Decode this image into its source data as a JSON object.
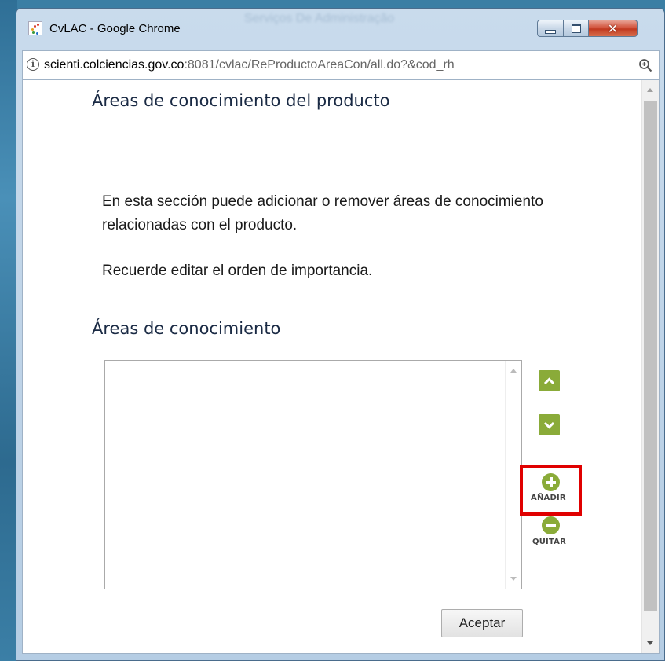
{
  "window": {
    "title": "CvLAC - Google Chrome",
    "background_title": "Serviços De Administração"
  },
  "address": {
    "host": "scienti.colciencias.gov.co",
    "rest": ":8081/cvlac/ReProductoAreaCon/all.do?&cod_rh"
  },
  "page": {
    "heading": "Áreas de conocimiento del producto",
    "paragraph1": "En esta sección puede adicionar o remover áreas de conocimiento relacionadas con el producto.",
    "paragraph2": "Recuerde editar el orden de importancia.",
    "subheading": "Áreas de conocimiento"
  },
  "actions": {
    "add_label": "AÑADIR",
    "remove_label": "QUITAR",
    "accept_label": "Aceptar"
  },
  "colors": {
    "action_green": "#8aab39",
    "highlight_red": "#e00000"
  }
}
